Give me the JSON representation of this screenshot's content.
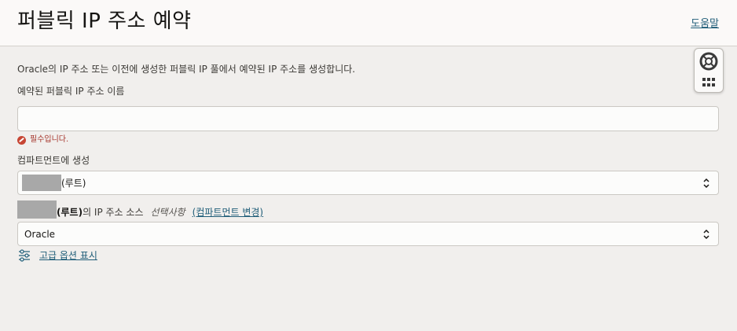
{
  "header": {
    "title": "퍼블릭 IP 주소 예약",
    "help_label": "도움말"
  },
  "form": {
    "description": "Oracle의 IP 주소 또는 이전에 생성한 퍼블릭 IP 풀에서 예약된 IP 주소를 생성합니다.",
    "name_label": "예약된 퍼블릭 IP 주소 이름",
    "name_value": "",
    "name_error": "필수입니다.",
    "compartment_label": "컴파트먼트에 생성",
    "compartment_value": "(루트)",
    "source_root_label": "(루트)",
    "source_label_suffix": "의 IP 주소 소스",
    "source_optional": "선택사항",
    "change_compartment": "(컴파트먼트 변경)",
    "source_value": "Oracle",
    "advanced_options": "고급 옵션 표시"
  },
  "colors": {
    "link": "#1f5d78",
    "error": "#c74634",
    "background": "#f1efed"
  },
  "icons": {
    "error": "error-circle-icon",
    "advanced": "sliders-icon",
    "help_widget": "lifebuoy-icon",
    "apps": "grid-icon"
  }
}
